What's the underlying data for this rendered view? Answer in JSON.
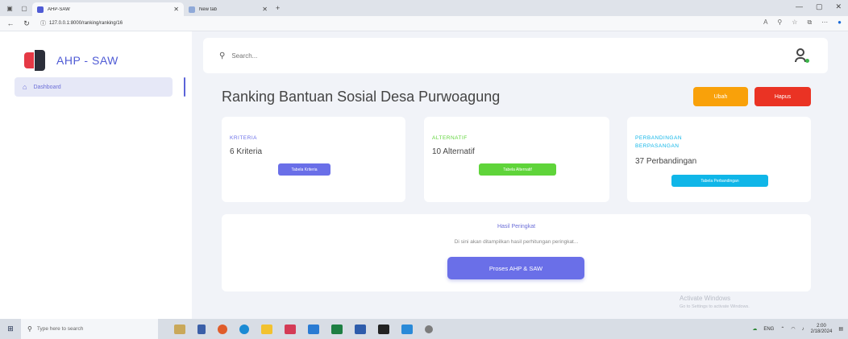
{
  "browser": {
    "tabs": [
      {
        "title": "AHP-SAW",
        "active": true
      },
      {
        "title": "New tab",
        "active": false
      }
    ],
    "url": "127.0.0.1:8000/ranking/ranking/16"
  },
  "sidebar": {
    "brand": "AHP - SAW",
    "items": [
      {
        "label": "Dashboard",
        "active": true
      }
    ]
  },
  "header": {
    "search_placeholder": "Search..."
  },
  "page": {
    "title": "Ranking Bantuan Sosial Desa Purwoagung",
    "edit_label": "Ubah",
    "delete_label": "Hapus"
  },
  "cards": [
    {
      "label": "KRITERIA",
      "value": "6 Kriteria",
      "button": "Tabela Kriteria",
      "color": "#6a6fe8"
    },
    {
      "label": "ALTERNATIF",
      "value": "10 Alternatif",
      "button": "Tabela Alternatif",
      "color": "#5fd43a"
    },
    {
      "label": "PERBANDINGAN BERPASANGAN",
      "value": "37 Perbandingan",
      "button": "Tabela Perbandingan",
      "color": "#10b6e8"
    }
  ],
  "result": {
    "title": "Hasil Peringkat",
    "subtitle": "Di sini akan ditampilkan hasil perhitungan peringkat...",
    "button": "Proses AHP & SAW"
  },
  "watermark": {
    "line1": "Activate Windows",
    "line2": "Go to Settings to activate Windows."
  },
  "taskbar": {
    "search_placeholder": "Type here to search",
    "lang": "ENG",
    "time": "2:00",
    "date": "2/18/2024"
  },
  "colors": {
    "accent": "#6a6fe8",
    "warning": "#f9a10a",
    "danger": "#ea3324",
    "success": "#5fd43a",
    "info": "#10b6e8"
  }
}
